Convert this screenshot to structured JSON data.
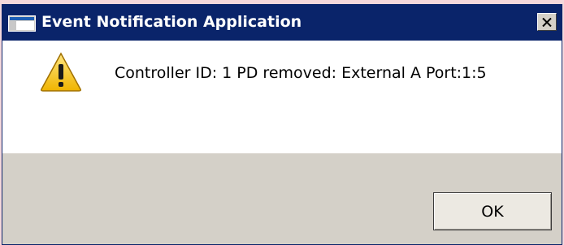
{
  "window": {
    "title": "Event Notification Application",
    "titlebar_color": "#0a246a",
    "title_color": "#ffffff",
    "app_icon": "app-window-icon",
    "close_icon": "close-icon"
  },
  "dialog": {
    "icon": "warning-icon",
    "message": "Controller ID: 1  PD removed: External A Port:1:5",
    "content_background": "#ffffff",
    "footer_background": "#d4d0c8"
  },
  "buttons": {
    "ok_label": "OK"
  }
}
